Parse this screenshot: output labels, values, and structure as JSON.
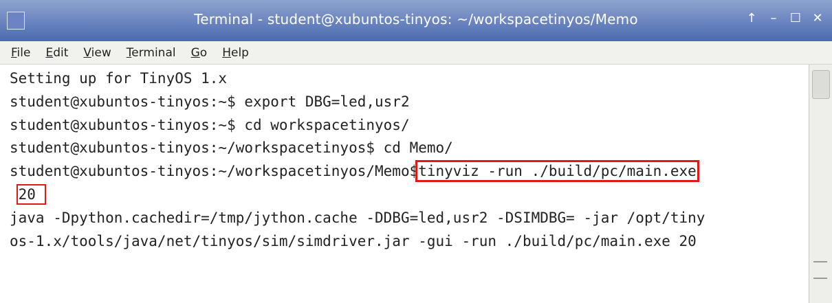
{
  "window": {
    "title": "Terminal - student@xubuntos-tinyos: ~/workspacetinyos/Memo",
    "controls": {
      "pin": "↑",
      "minimize": "–",
      "maximize": "☐",
      "close": "✕"
    }
  },
  "menu": {
    "file": {
      "mnemonic": "F",
      "rest": "ile"
    },
    "edit": {
      "mnemonic": "E",
      "rest": "dit"
    },
    "view": {
      "mnemonic": "V",
      "rest": "iew"
    },
    "terminal": {
      "mnemonic": "T",
      "rest": "erminal"
    },
    "go": {
      "mnemonic": "G",
      "rest": "o"
    },
    "help": {
      "mnemonic": "H",
      "rest": "elp"
    }
  },
  "terminal": {
    "lines": [
      "Setting up for TinyOS 1.x",
      "student@xubuntos-tinyos:~$ export DBG=led,usr2",
      "student@xubuntos-tinyos:~$ cd workspacetinyos/",
      "student@xubuntos-tinyos:~/workspacetinyos$ cd Memo/"
    ],
    "prompt_line": {
      "prompt": "student@xubuntos-tinyos:~/workspacetinyos/Memo$",
      "command": "tinyviz -run ./build/pc/main.exe"
    },
    "wrap_arg": "20",
    "output_lines": [
      "java -Dpython.cachedir=/tmp/jython.cache -DDBG=led,usr2 -DSIMDBG= -jar /opt/tiny",
      "os-1.x/tools/java/net/tinyos/sim/simdriver.jar -gui -run ./build/pc/main.exe 20"
    ]
  },
  "colors": {
    "titlebar": "#4a6ab0",
    "highlight": "#e01818",
    "text": "#222222"
  }
}
